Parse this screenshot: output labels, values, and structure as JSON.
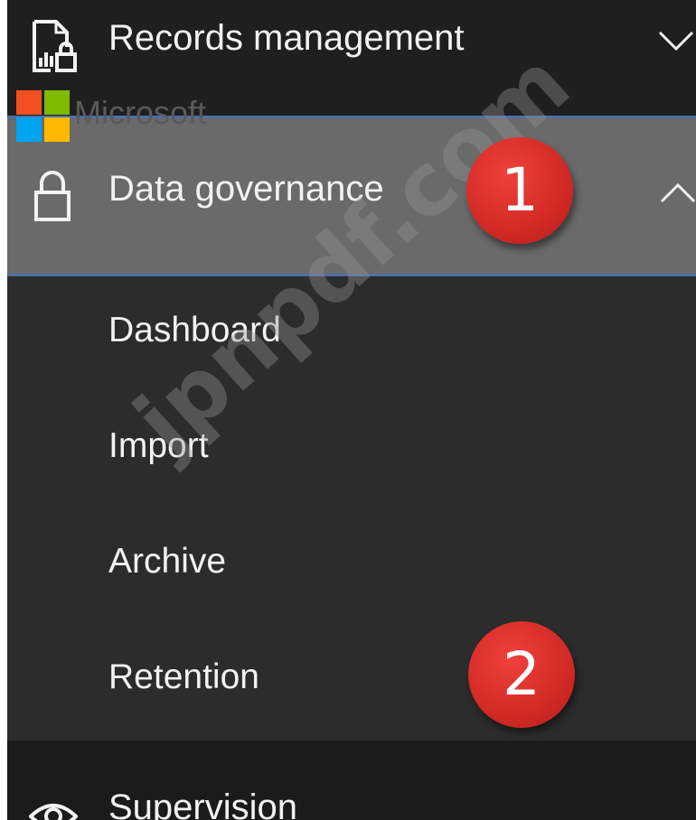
{
  "nav": {
    "records_management": {
      "label": "Records management",
      "icon": "records-icon",
      "chevron": "chevron-down-icon"
    },
    "microsoft_logo_text": "Microsoft",
    "data_governance": {
      "label": "Data governance",
      "icon": "lock-icon",
      "chevron": "chevron-up-icon",
      "expanded": true
    },
    "submenu": [
      {
        "label": "Dashboard"
      },
      {
        "label": "Import"
      },
      {
        "label": "Archive"
      },
      {
        "label": "Retention"
      }
    ],
    "supervision": {
      "label": "Supervision",
      "icon": "eye-icon"
    }
  },
  "annotations": {
    "badge_1": "1",
    "badge_2": "2",
    "badge_color": "#d22a26"
  },
  "watermark": "jpnpdf.com",
  "colors": {
    "panel_bg": "#1f1f1f",
    "selected_bg": "#6a6a6a",
    "selected_border": "#4c6fa8",
    "submenu_bg": "#2c2c2c",
    "text": "#f2f2f2"
  }
}
